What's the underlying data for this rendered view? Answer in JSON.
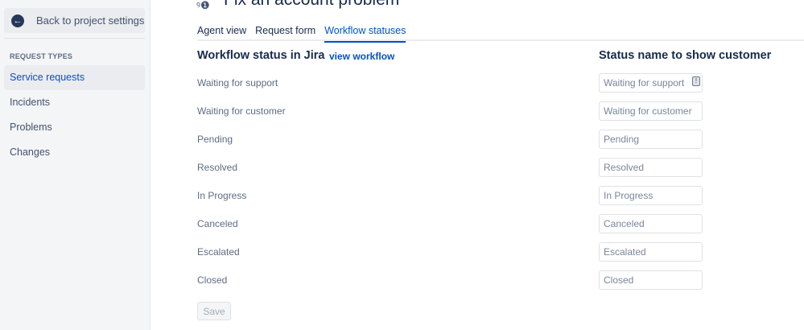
{
  "sidebar": {
    "back_label": "Back to project settings",
    "section": "REQUEST TYPES",
    "items": [
      {
        "label": "Service requests"
      },
      {
        "label": "Incidents"
      },
      {
        "label": "Problems"
      },
      {
        "label": "Changes"
      }
    ]
  },
  "page": {
    "title": "Fix an account problem"
  },
  "tabs": [
    {
      "label": "Agent view"
    },
    {
      "label": "Request form"
    },
    {
      "label": "Workflow statuses"
    }
  ],
  "table": {
    "col1": "Workflow status in Jira",
    "view_link": "view workflow",
    "col2": "Status name to show customer",
    "rows": [
      {
        "status": "Waiting for support",
        "placeholder": "Waiting for support"
      },
      {
        "status": "Waiting for customer",
        "placeholder": "Waiting for customer"
      },
      {
        "status": "Pending",
        "placeholder": "Pending"
      },
      {
        "status": "Resolved",
        "placeholder": "Resolved"
      },
      {
        "status": "In Progress",
        "placeholder": "In Progress"
      },
      {
        "status": "Canceled",
        "placeholder": "Canceled"
      },
      {
        "status": "Escalated",
        "placeholder": "Escalated"
      },
      {
        "status": "Closed",
        "placeholder": "Closed"
      }
    ]
  },
  "save_label": "Save"
}
